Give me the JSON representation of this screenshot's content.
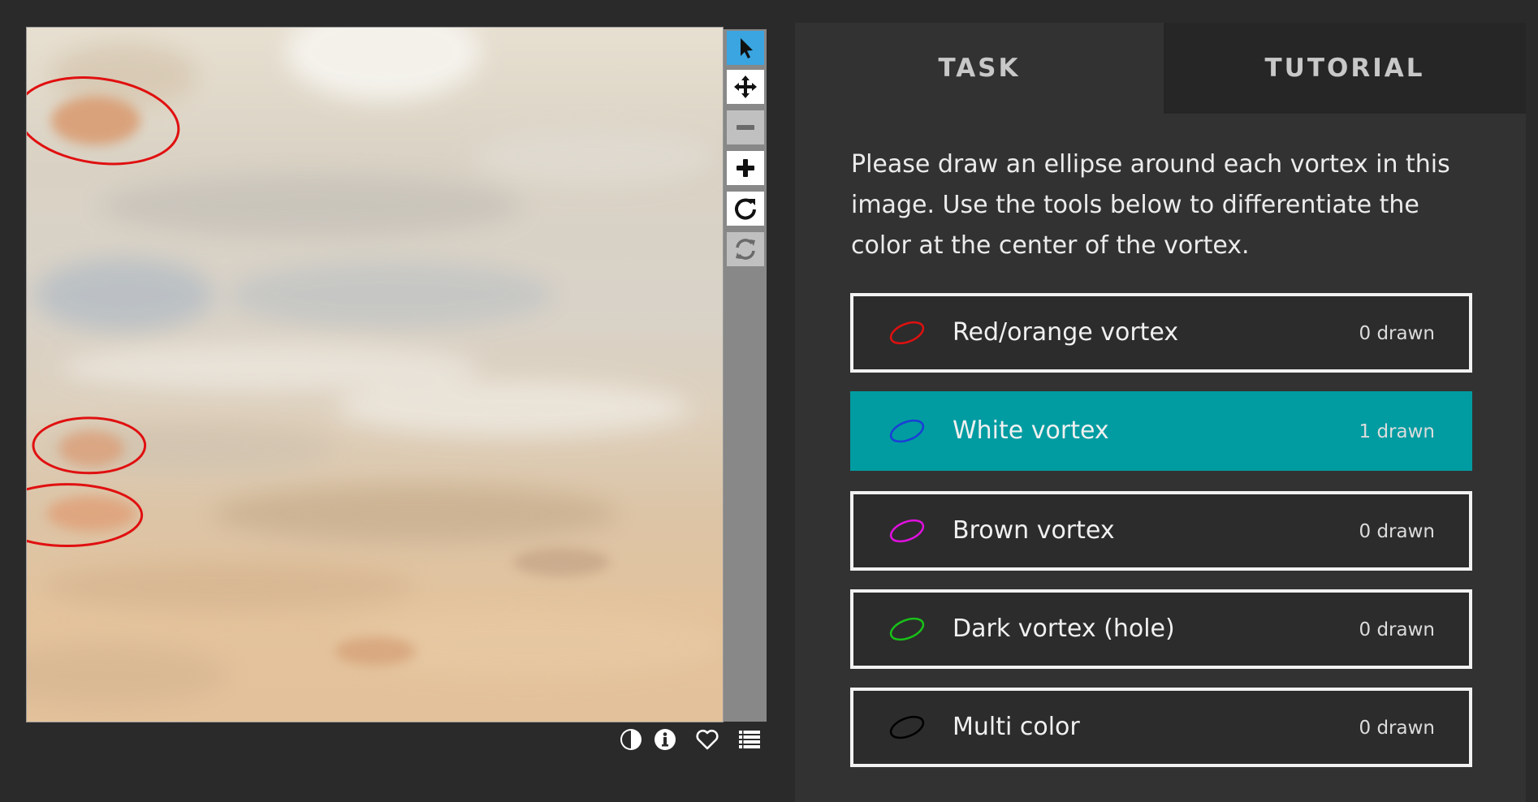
{
  "tabs": {
    "task": "TASK",
    "tutorial": "TUTORIAL"
  },
  "instructions": "Please draw an ellipse around each vortex in this image. Use the tools below to differentiate the color at the center of the vortex.",
  "choices": [
    {
      "label": "Red/orange vortex",
      "count": "0 drawn",
      "color": "#e01010",
      "selected": false
    },
    {
      "label": "White vortex",
      "count": "1 drawn",
      "color": "#1a3ed6",
      "selected": true
    },
    {
      "label": "Brown vortex",
      "count": "0 drawn",
      "color": "#e010e0",
      "selected": false
    },
    {
      "label": "Dark vortex (hole)",
      "count": "0 drawn",
      "color": "#18c018",
      "selected": false
    },
    {
      "label": "Multi color",
      "count": "0 drawn",
      "color": "#000000",
      "selected": false
    }
  ],
  "toolbar": {
    "tools": [
      "pointer-icon",
      "move-icon",
      "zoom-out-icon",
      "zoom-in-icon",
      "rotate-icon",
      "reset-icon"
    ],
    "active": "pointer-icon",
    "disabled": [
      "zoom-out-icon",
      "reset-icon"
    ]
  },
  "image_meta_icons": [
    "invert-icon",
    "info-icon",
    "heart-icon",
    "list-icon"
  ],
  "colors": {
    "background": "#2a2a2a",
    "panel": "#323232",
    "selected_choice": "#009ca1",
    "active_tool": "#3aa5e0",
    "drawn_ellipse": "#e01010"
  }
}
